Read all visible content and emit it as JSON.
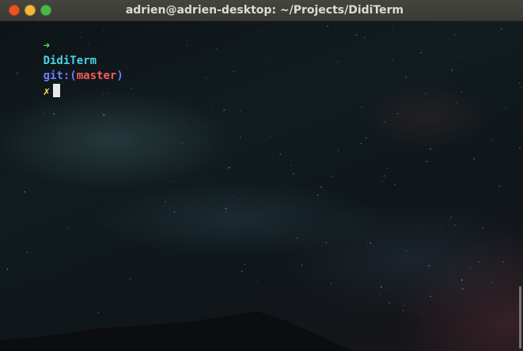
{
  "window": {
    "title": "adrien@adrien-desktop: ~/Projects/DidiTerm",
    "buttons": [
      {
        "name": "close",
        "color": "#e95420"
      },
      {
        "name": "minimize",
        "color": "#f5b73a"
      },
      {
        "name": "maximize",
        "color": "#4cb848"
      }
    ]
  },
  "prompt": {
    "arrow": "➜",
    "directory": "DidiTerm",
    "git_prefix": "git:(",
    "branch": "master",
    "git_suffix": ")",
    "dirty_marker": "✗",
    "colors": {
      "arrow": "#4ee44e",
      "directory": "#49d2e6",
      "git": "#6f7cff",
      "branch": "#ff5a5a",
      "dirty": "#ffe84a"
    }
  }
}
